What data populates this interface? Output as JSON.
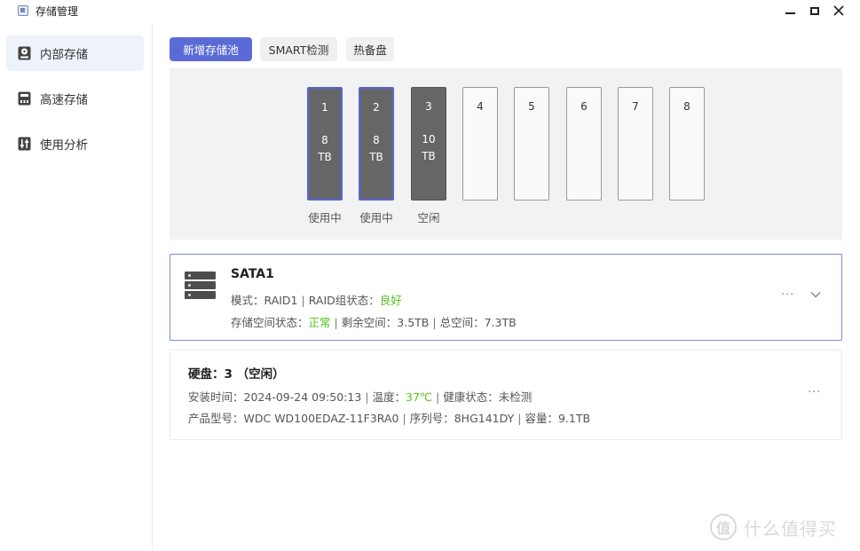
{
  "window": {
    "title": "存储管理"
  },
  "sidebar": {
    "items": [
      {
        "label": "内部存储",
        "icon": "hdd-icon",
        "active": true
      },
      {
        "label": "高速存储",
        "icon": "m2-icon",
        "active": false
      },
      {
        "label": "使用分析",
        "icon": "sliders-icon",
        "active": false
      }
    ]
  },
  "toolbar": {
    "new_pool": "新增存储池",
    "smart": "SMART检测",
    "hot_spare": "热备盘"
  },
  "bays": [
    {
      "number": "1",
      "capacity": "8",
      "unit": "TB",
      "state": "used",
      "status": "使用中"
    },
    {
      "number": "2",
      "capacity": "8",
      "unit": "TB",
      "state": "used",
      "status": "使用中"
    },
    {
      "number": "3",
      "capacity": "10",
      "unit": "TB",
      "state": "idle",
      "status": "空闲"
    },
    {
      "number": "4",
      "capacity": "",
      "unit": "",
      "state": "empty",
      "status": ""
    },
    {
      "number": "5",
      "capacity": "",
      "unit": "",
      "state": "empty",
      "status": ""
    },
    {
      "number": "6",
      "capacity": "",
      "unit": "",
      "state": "empty",
      "status": ""
    },
    {
      "number": "7",
      "capacity": "",
      "unit": "",
      "state": "empty",
      "status": ""
    },
    {
      "number": "8",
      "capacity": "",
      "unit": "",
      "state": "empty",
      "status": ""
    }
  ],
  "pool": {
    "name": "SATA1",
    "mode_label": "模式：",
    "mode": "RAID1",
    "raid_status_label": "RAID组状态：",
    "raid_status": "良好",
    "space_status_label": "存储空间状态：",
    "space_status": "正常",
    "free_label": "剩余空间：",
    "free": "3.5TB",
    "total_label": "总空间：",
    "total": "7.3TB",
    "more": "···"
  },
  "disk": {
    "title": "硬盘：3 （空闲）",
    "install_label": "安装时间：",
    "install_time": "2024-09-24 09:50:13",
    "temp_label": "温度：",
    "temp": "37℃",
    "health_label": "健康状态：",
    "health": "未检测",
    "model_label": "产品型号：",
    "model": "WDC WD100EDAZ-11F3RA0",
    "serial_label": "序列号：",
    "serial": "8HG141DY",
    "capacity_label": "容量：",
    "capacity": "9.1TB",
    "more": "···"
  },
  "watermark": {
    "glyph": "值",
    "text": "什么值得买"
  },
  "colors": {
    "accent": "#5b6bd6",
    "ok": "#52c41a",
    "bay_used_border": "#5666d8"
  }
}
